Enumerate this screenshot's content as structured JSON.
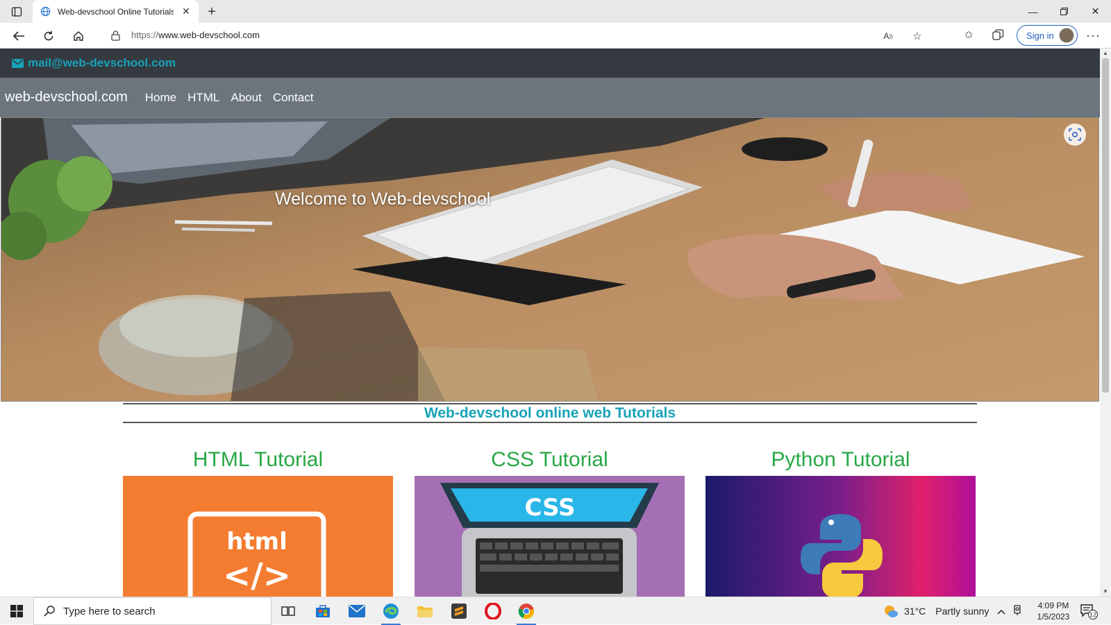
{
  "browser": {
    "tab_title": "Web-devschool Online Tutorials",
    "url_protocol": "https://",
    "url_host": "www.web-devschool.com",
    "signin_label": "Sign in"
  },
  "site": {
    "email": "mail@web-devschool.com",
    "brand": "web-devschool.com",
    "nav": [
      "Home",
      "HTML",
      "About",
      "Contact"
    ],
    "hero_title": "Welcome to Web-devschool",
    "section_heading": "Web-devschool online web Tutorials",
    "cards": [
      {
        "title": "HTML Tutorial",
        "image_text": "html",
        "image_code": "</>",
        "bg": "#f47c30"
      },
      {
        "title": "CSS Tutorial",
        "image_text": "CSS",
        "bg": "#a46fb4"
      },
      {
        "title": "Python Tutorial",
        "bg": "#a0168a"
      }
    ],
    "colors": {
      "topbar": "#343a40",
      "navbar": "#6c757d",
      "accent_teal": "#17a2b8",
      "accent_green": "#28a745"
    }
  },
  "taskbar": {
    "search_placeholder": "Type here to search",
    "temperature": "31°C",
    "weather_text": "Partly sunny",
    "time": "4:09 PM",
    "date": "1/5/2023",
    "notification_count": "12"
  }
}
